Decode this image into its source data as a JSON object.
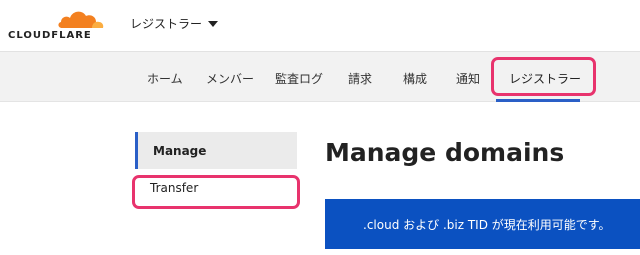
{
  "header": {
    "logo_text": "CLOUDFLARE",
    "account_label": "レジストラー"
  },
  "nav": {
    "items": [
      {
        "label": "ホーム"
      },
      {
        "label": "メンバー"
      },
      {
        "label": "監査ログ"
      },
      {
        "label": "請求"
      },
      {
        "label": "構成"
      },
      {
        "label": "通知"
      },
      {
        "label": "レジストラー"
      }
    ],
    "active_index": 6
  },
  "sidebar": {
    "items": [
      {
        "label": "Manage"
      },
      {
        "label": "Transfer"
      }
    ],
    "active_index": 0
  },
  "main": {
    "title": "Manage domains",
    "banner_text": ".cloud および .biz TID が現在利用可能です。"
  },
  "colors": {
    "brand_orange": "#f38020",
    "accent_blue": "#2a5fc7",
    "banner_blue": "#0b51c1",
    "highlight_pink": "#e8336d"
  }
}
